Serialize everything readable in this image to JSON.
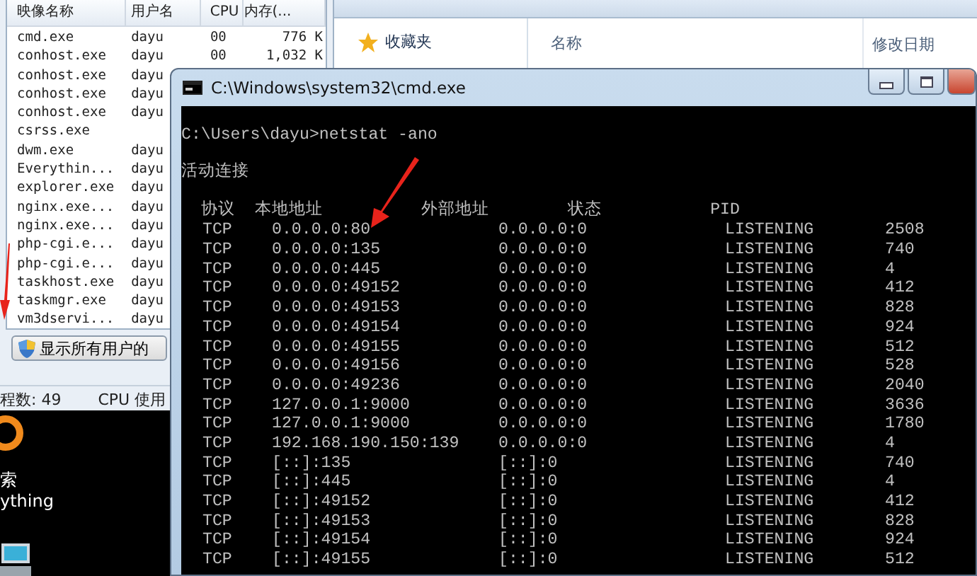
{
  "task_manager": {
    "columns": [
      "映像名称",
      "用户名",
      "CPU",
      "内存(..."
    ],
    "rows": [
      {
        "image": "cmd.exe",
        "user": "dayu",
        "cpu": "00",
        "memory": "776 K"
      },
      {
        "image": "conhost.exe",
        "user": "dayu",
        "cpu": "00",
        "memory": "1,032 K"
      },
      {
        "image": "conhost.exe",
        "user": "dayu"
      },
      {
        "image": "conhost.exe",
        "user": "dayu"
      },
      {
        "image": "conhost.exe",
        "user": "dayu"
      },
      {
        "image": "csrss.exe"
      },
      {
        "image": "dwm.exe",
        "user": "dayu"
      },
      {
        "image": "Everythin...",
        "user": "dayu"
      },
      {
        "image": "explorer.exe",
        "user": "dayu"
      },
      {
        "image": "nginx.exe...",
        "user": "dayu"
      },
      {
        "image": "nginx.exe...",
        "user": "dayu"
      },
      {
        "image": "php-cgi.e...",
        "user": "dayu"
      },
      {
        "image": "php-cgi.e...",
        "user": "dayu"
      },
      {
        "image": "taskhost.exe",
        "user": "dayu"
      },
      {
        "image": "taskmgr.exe",
        "user": "dayu"
      },
      {
        "image": "vm3dservi...",
        "user": "dayu"
      }
    ],
    "button": "显示所有用户的",
    "status": [
      "程数: 49",
      "CPU 使用"
    ]
  },
  "explorer": {
    "nav": [
      "收藏夹"
    ],
    "columns": [
      "名称",
      "修改日期"
    ]
  },
  "desktop": {
    "labels": [
      "索",
      "ything"
    ]
  },
  "cmd": {
    "title": "C:\\Windows\\system32\\cmd.exe",
    "prompt": "C:\\Users\\dayu>netstat -ano",
    "section": "活动连接",
    "header_line": "  协议  本地地址          外部地址        状态           PID",
    "rows": [
      [
        "TCP",
        "0.0.0.0:80",
        "0.0.0.0:0",
        "LISTENING",
        "2508"
      ],
      [
        "TCP",
        "0.0.0.0:135",
        "0.0.0.0:0",
        "LISTENING",
        "740"
      ],
      [
        "TCP",
        "0.0.0.0:445",
        "0.0.0.0:0",
        "LISTENING",
        "4"
      ],
      [
        "TCP",
        "0.0.0.0:49152",
        "0.0.0.0:0",
        "LISTENING",
        "412"
      ],
      [
        "TCP",
        "0.0.0.0:49153",
        "0.0.0.0:0",
        "LISTENING",
        "828"
      ],
      [
        "TCP",
        "0.0.0.0:49154",
        "0.0.0.0:0",
        "LISTENING",
        "924"
      ],
      [
        "TCP",
        "0.0.0.0:49155",
        "0.0.0.0:0",
        "LISTENING",
        "512"
      ],
      [
        "TCP",
        "0.0.0.0:49156",
        "0.0.0.0:0",
        "LISTENING",
        "528"
      ],
      [
        "TCP",
        "0.0.0.0:49236",
        "0.0.0.0:0",
        "LISTENING",
        "2040"
      ],
      [
        "TCP",
        "127.0.0.1:9000",
        "0.0.0.0:0",
        "LISTENING",
        "3636"
      ],
      [
        "TCP",
        "127.0.0.1:9000",
        "0.0.0.0:0",
        "LISTENING",
        "1780"
      ],
      [
        "TCP",
        "192.168.190.150:139",
        "0.0.0.0:0",
        "LISTENING",
        "4"
      ],
      [
        "TCP",
        "[::]:135",
        "[::]:0",
        "LISTENING",
        "740"
      ],
      [
        "TCP",
        "[::]:445",
        "[::]:0",
        "LISTENING",
        "4"
      ],
      [
        "TCP",
        "[::]:49152",
        "[::]:0",
        "LISTENING",
        "412"
      ],
      [
        "TCP",
        "[::]:49153",
        "[::]:0",
        "LISTENING",
        "828"
      ],
      [
        "TCP",
        "[::]:49154",
        "[::]:0",
        "LISTENING",
        "924"
      ],
      [
        "TCP",
        "[::]:49155",
        "[::]:0",
        "LISTENING",
        "512"
      ]
    ]
  }
}
